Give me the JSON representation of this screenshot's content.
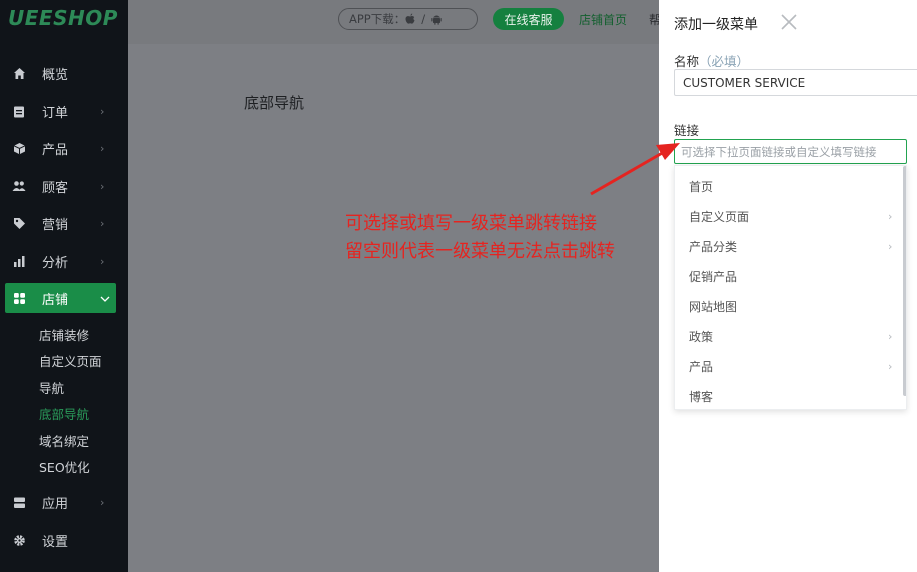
{
  "sidebar": {
    "logo": "UEESHOP",
    "items": [
      {
        "label": "概览",
        "icon": "home-icon",
        "has_children": false
      },
      {
        "label": "订单",
        "icon": "clipboard-icon",
        "has_children": true
      },
      {
        "label": "产品",
        "icon": "box-icon",
        "has_children": true
      },
      {
        "label": "顾客",
        "icon": "users-icon",
        "has_children": true
      },
      {
        "label": "营销",
        "icon": "tag-icon",
        "has_children": true
      },
      {
        "label": "分析",
        "icon": "bar-chart-icon",
        "has_children": true
      },
      {
        "label": "店铺",
        "icon": "grid-icon",
        "has_children": true,
        "active": true
      },
      {
        "label": "应用",
        "icon": "stack-icon",
        "has_children": true
      },
      {
        "label": "设置",
        "icon": "gear-icon",
        "has_children": false
      }
    ],
    "store_subitems": [
      {
        "label": "店铺装修"
      },
      {
        "label": "自定义页面"
      },
      {
        "label": "导航"
      },
      {
        "label": "底部导航",
        "active": true
      },
      {
        "label": "域名绑定"
      },
      {
        "label": "SEO优化"
      }
    ]
  },
  "topbar": {
    "app_download_label": "APP下载：",
    "app_separator": "/",
    "service_button": "在线客服",
    "store_home_link": "店铺首页",
    "help_link": "帮"
  },
  "main": {
    "page_title": "底部导航"
  },
  "panel": {
    "title": "添加一级菜单",
    "name_label": "名称",
    "name_required": "（必填）",
    "name_value": "CUSTOMER SERVICE",
    "link_label": "链接",
    "link_placeholder": "可选择下拉页面链接或自定义填写链接",
    "dropdown_options": [
      {
        "label": "首页",
        "has_children": false
      },
      {
        "label": "自定义页面",
        "has_children": true
      },
      {
        "label": "产品分类",
        "has_children": true
      },
      {
        "label": "促销产品",
        "has_children": false
      },
      {
        "label": "网站地图",
        "has_children": false
      },
      {
        "label": "政策",
        "has_children": true
      },
      {
        "label": "产品",
        "has_children": true
      },
      {
        "label": "博客",
        "has_children": false
      }
    ]
  },
  "annotation": {
    "line1": "可选择或填写一级菜单跳转链接",
    "line2": "留空则代表一级菜单无法点击跳转",
    "color": "#e52420"
  },
  "colors": {
    "brand_green": "#1a8d48",
    "sidebar_bg": "#101419",
    "overlay_gray": "#7d7f84"
  }
}
